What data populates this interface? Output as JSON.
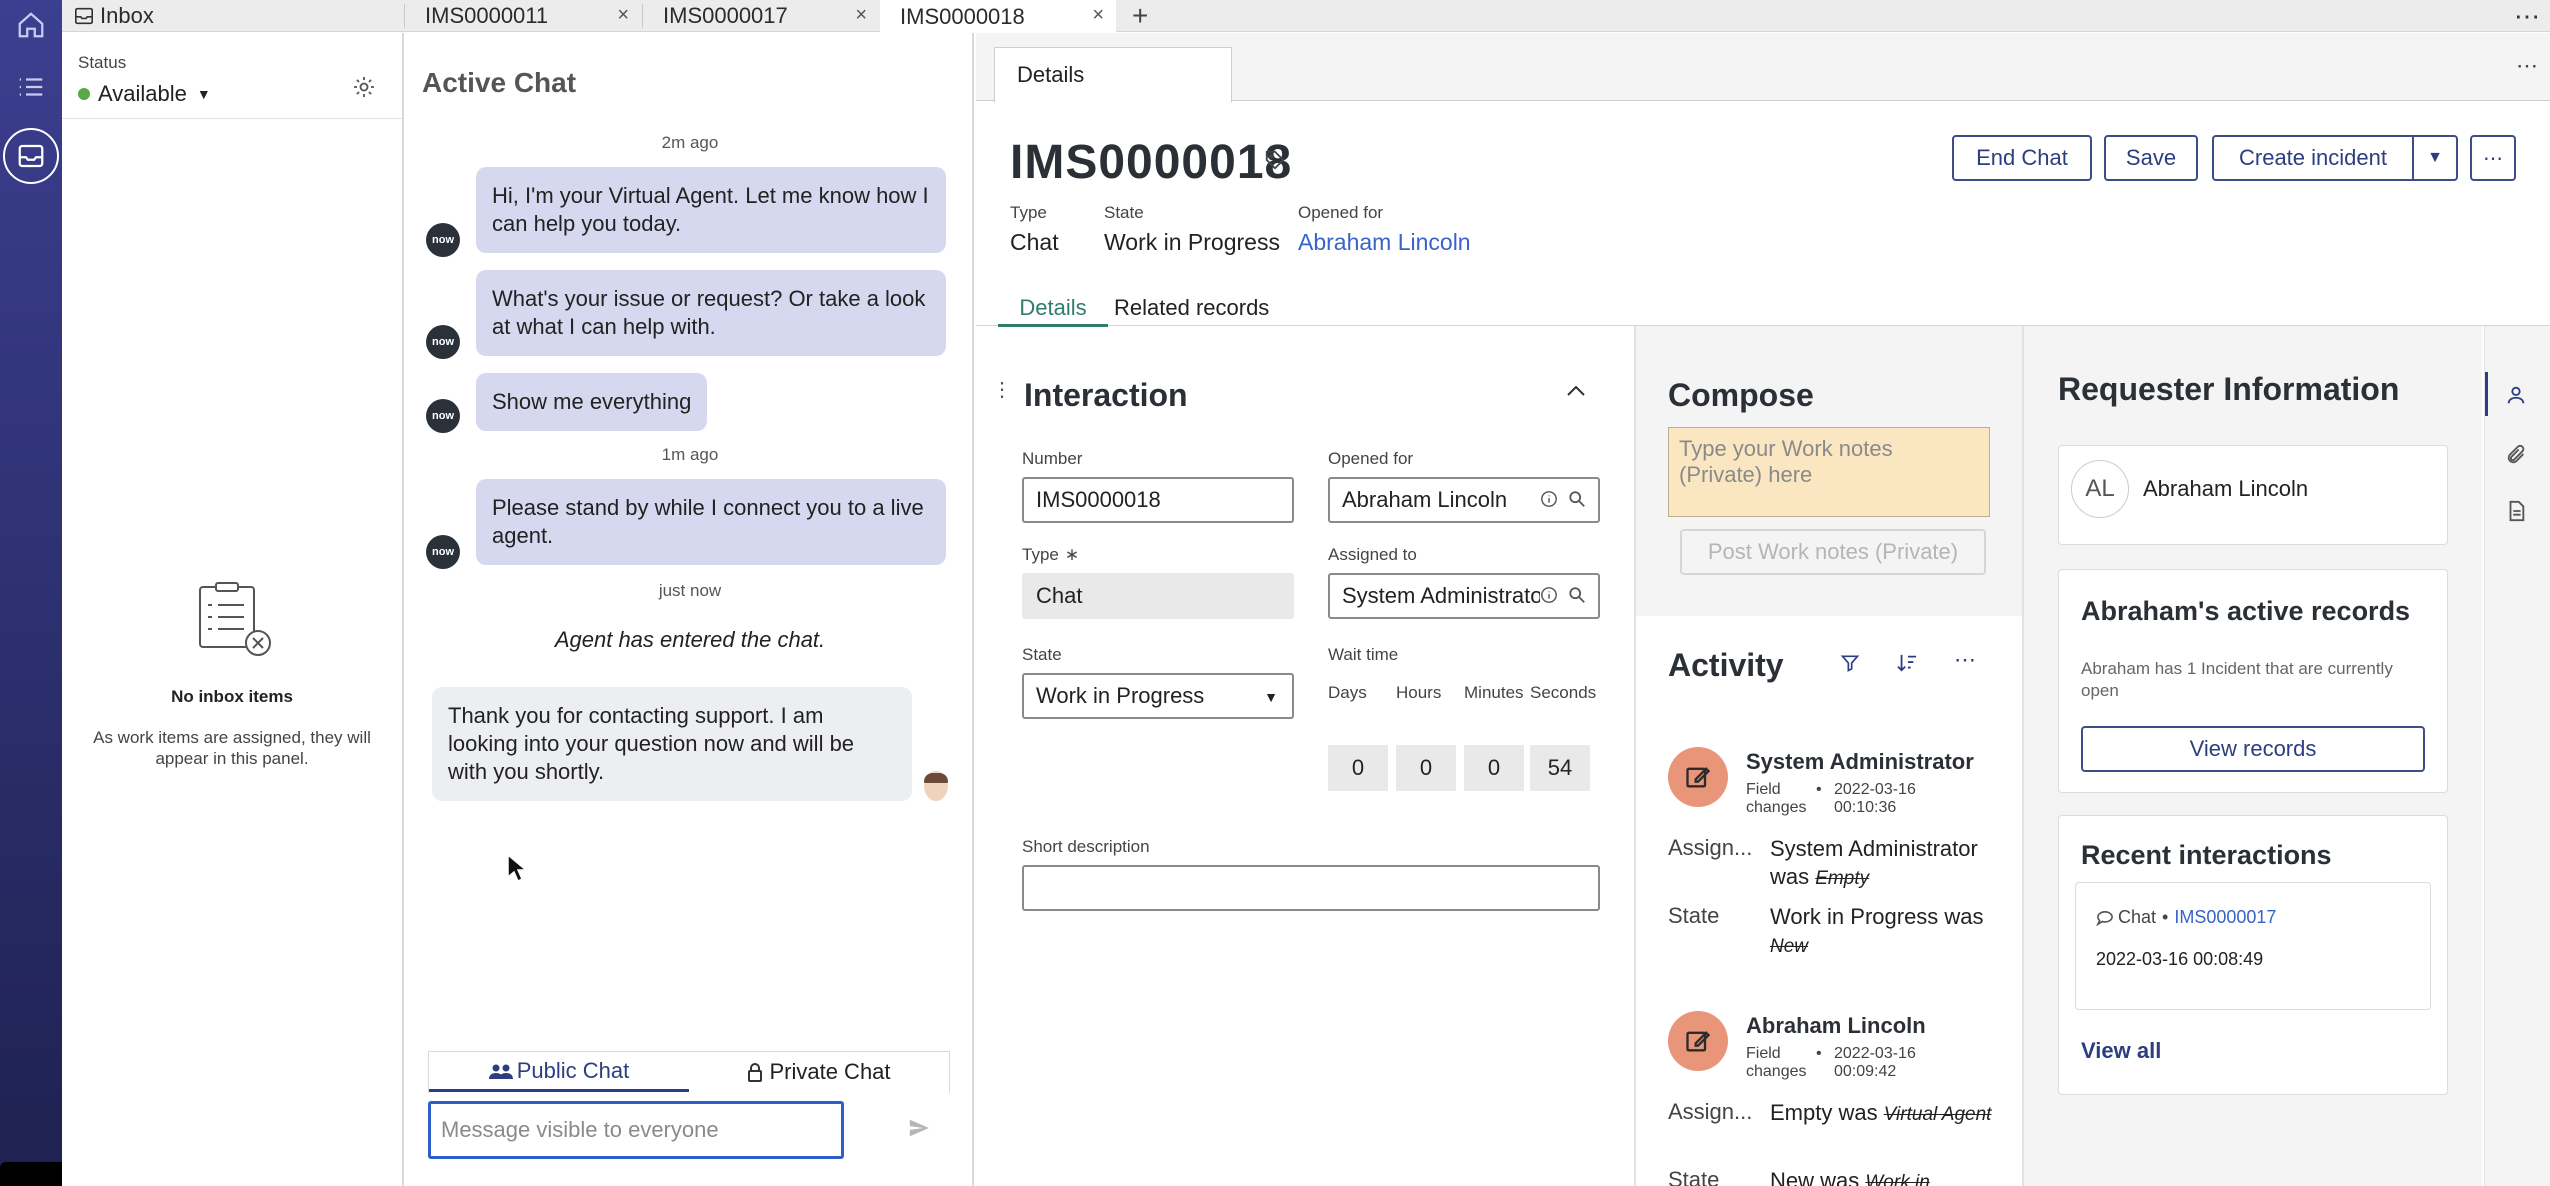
{
  "tabs": {
    "inbox_label": "Inbox",
    "tab1": "IMS0000011",
    "tab2": "IMS0000017",
    "tab3": "IMS0000018",
    "close_glyph": "×",
    "add_glyph": "+",
    "more_glyph": "⋯"
  },
  "inbox": {
    "status_label": "Status",
    "status_value": "Available",
    "empty_title": "No inbox items",
    "empty_text": "As work items are assigned, they will appear in this panel."
  },
  "chat": {
    "title": "Active Chat",
    "avatar_text": "now",
    "ts1": "2m ago",
    "msg1": "Hi, I'm your Virtual Agent. Let me know how I can help you today.",
    "msg2": "What's your issue or request? Or take a look at what I can help with.",
    "msg3": "Show me everything",
    "ts2": "1m ago",
    "msg4": "Please stand by while I connect you to a live agent.",
    "ts3": "just now",
    "system_msg": "Agent has entered the chat.",
    "msg5": "Thank you for contacting support. I am looking into your question now and will be with you shortly.",
    "public_tab": "Public Chat",
    "private_tab": "Private Chat",
    "input_placeholder": "Message visible to everyone"
  },
  "details": {
    "tab_label": "Details",
    "record_id": "IMS0000018",
    "type_label": "Type",
    "type_value": "Chat",
    "state_label": "State",
    "state_value": "Work in Progress",
    "opened_for_label": "Opened for",
    "opened_for_value": "Abraham Lincoln",
    "end_chat": "End Chat",
    "save": "Save",
    "create_incident": "Create incident",
    "subtab_details": "Details",
    "subtab_related": "Related records"
  },
  "interaction": {
    "title": "Interaction",
    "number_label": "Number",
    "number_value": "IMS0000018",
    "opened_for_label": "Opened for",
    "opened_for_value": "Abraham Lincoln",
    "type_label": "Type",
    "type_required": "∗",
    "type_value": "Chat",
    "assigned_label": "Assigned to",
    "assigned_value": "System Administrator",
    "state_label": "State",
    "state_value": "Work in Progress",
    "wait_label": "Wait time",
    "days_label": "Days",
    "hours_label": "Hours",
    "minutes_label": "Minutes",
    "seconds_label": "Seconds",
    "days": "0",
    "hours": "0",
    "minutes": "0",
    "seconds": "54",
    "short_desc_label": "Short description"
  },
  "compose": {
    "title": "Compose",
    "placeholder": "Type your Work notes (Private) here",
    "post_button": "Post Work notes (Private)"
  },
  "activity": {
    "title": "Activity",
    "entry1_author": "System Administrator",
    "entry1_type": "Field changes",
    "entry1_date": "2022-03-16",
    "entry1_time": "00:10:36",
    "entry1_f1_label": "Assign...",
    "entry1_f1_new": "System Administrator was",
    "entry1_f1_old": "Empty",
    "entry1_f2_label": "State",
    "entry1_f2_new": "Work in Progress was",
    "entry1_f2_old": "New",
    "entry2_author": "Abraham Lincoln",
    "entry2_type": "Field changes",
    "entry2_date": "2022-03-16",
    "entry2_time": "00:09:42",
    "entry2_f1_label": "Assign...",
    "entry2_f1_new": "Empty was",
    "entry2_f1_old": "Virtual Agent",
    "entry2_f2_label": "State",
    "entry2_f2_new": "New was",
    "entry2_f2_old": "Work in Progress"
  },
  "requester": {
    "title": "Requester Information",
    "initials": "AL",
    "name": "Abraham Lincoln",
    "active_title": "Abraham's active records",
    "active_text": "Abraham has 1 Incident that are currently open",
    "view_records": "View records",
    "recent_title": "Recent interactions",
    "recent_type": "Chat",
    "recent_link": "IMS0000017",
    "recent_date": "2022-03-16 00:08:49",
    "view_all": "View all"
  },
  "colors": {
    "rail": "#2c2f6e",
    "accent": "#2c3e80",
    "link": "#3863c9",
    "bubble": "#d6d8ef",
    "activity_icon": "#e8957a",
    "available": "#5aa948"
  }
}
